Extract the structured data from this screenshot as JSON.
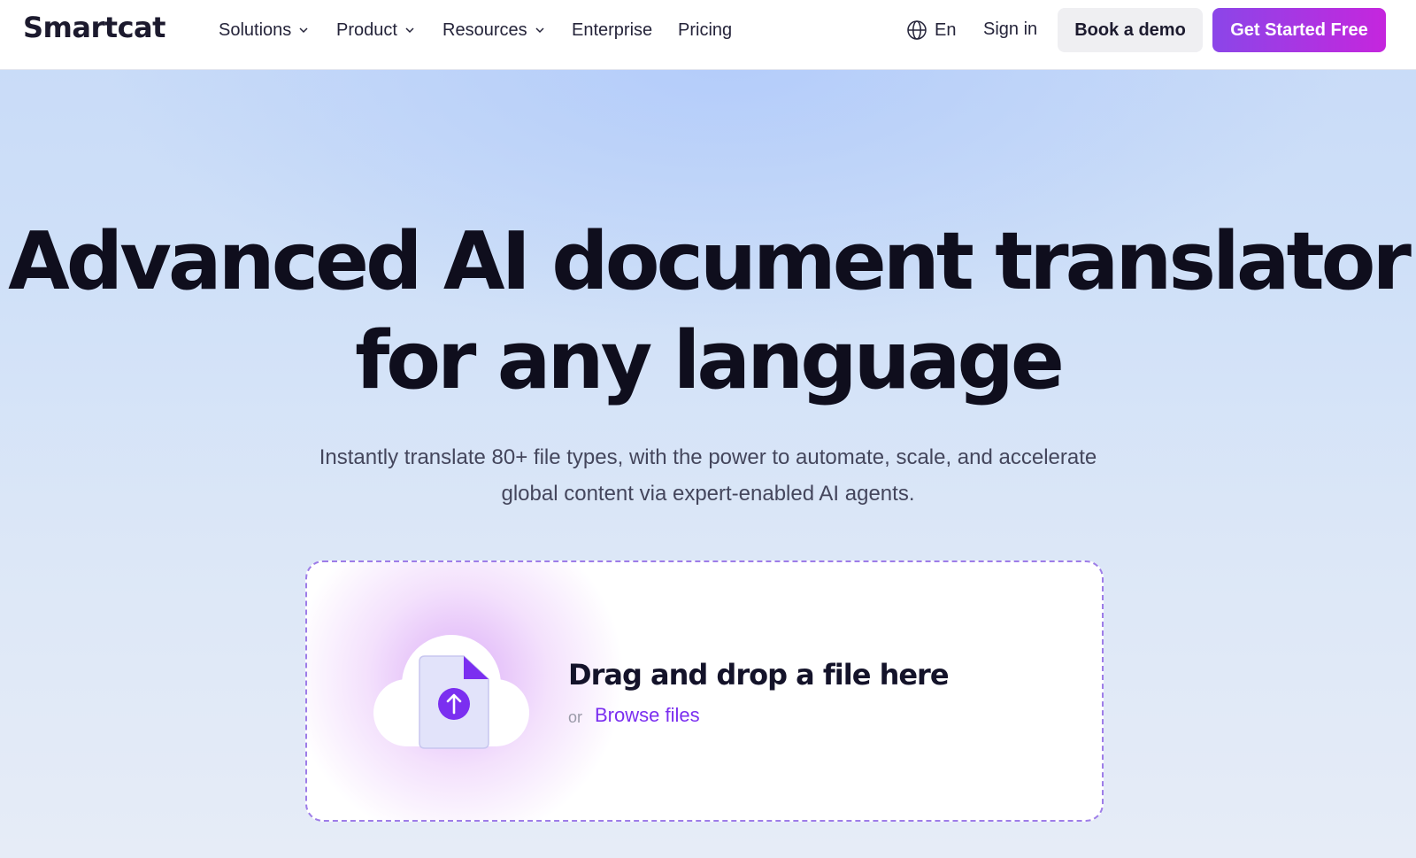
{
  "header": {
    "logo": "Smartcat",
    "nav": {
      "solutions": "Solutions",
      "product": "Product",
      "resources": "Resources",
      "enterprise": "Enterprise",
      "pricing": "Pricing"
    },
    "language": "En",
    "sign_in": "Sign in",
    "book_demo": "Book a demo",
    "get_started": "Get Started Free"
  },
  "hero": {
    "headline_line1": "Advanced AI document translator",
    "headline_line2": "for any language",
    "subtitle": "Instantly translate 80+ file types, with the power to automate, scale, and accelerate global content via expert-enabled AI agents."
  },
  "upload": {
    "title": "Drag and drop a file here",
    "or": "or",
    "browse": "Browse files"
  },
  "colors": {
    "accent_purple": "#7b2ff0",
    "cta_gradient_start": "#8b46e8",
    "cta_gradient_end": "#c526dd",
    "dropzone_border": "#9e7de8"
  },
  "icons": {
    "nav_dropdown": "chevron-down-icon",
    "language": "globe-icon",
    "upload": "upload-arrow-icon"
  }
}
